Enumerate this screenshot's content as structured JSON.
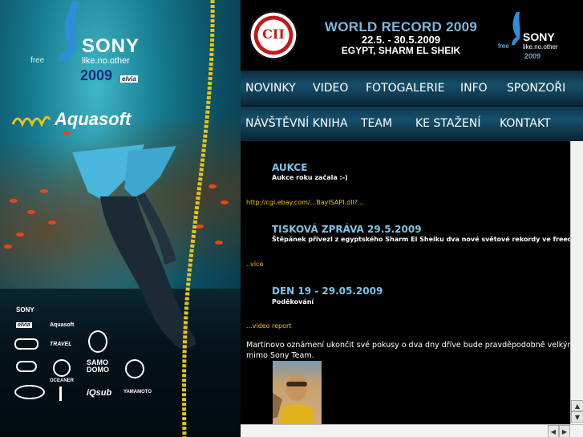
{
  "left_panel": {
    "free_label": "free",
    "sony": "SONY",
    "slogan": "like.no.other",
    "year": "2009",
    "elvia": "elvia",
    "aquasoft": "Aquasoft",
    "sponsors": [
      "SONY",
      "elvia",
      "Aquasoft",
      "TRAVEL",
      "SAMO DOMO",
      "OCEANER",
      "YAMAMOTO",
      "iQsub"
    ]
  },
  "header": {
    "logo_text": "CII",
    "title": "WORLD RECORD 2009",
    "dates": "22.5. - 30.5.2009",
    "place": "EGYPT, SHARM EL SHEIK",
    "sony_free": "free",
    "sony": "SONY",
    "sony_slogan": "like.no.other",
    "sony_year": "2009"
  },
  "nav": {
    "row1": [
      "NOVINKY",
      "VIDEO",
      "FOTOGALERIE",
      "INFO",
      "SPONZOŘI"
    ],
    "row2": [
      "NÁVŠTĚVNÍ KNIHA",
      "TEAM",
      "KE STAŽENÍ",
      "KONTAKT"
    ]
  },
  "posts": [
    {
      "title": "AUKCE",
      "subtitle": "Aukce roku začala :-)",
      "link": "http://cgi.ebay.com/...BayISAPI.dll?..."
    },
    {
      "title": "TISKOVÁ ZPRÁVA 29.5.2009",
      "subtitle": "Štěpánek přivezl z egyptského Sharm El Sheiku dva nové světové rekordy ve freedi",
      "link": "..více"
    },
    {
      "title": "DEN 19 - 29.05.2009",
      "subtitle": "Poděkování",
      "link": "...video report"
    }
  ],
  "body_text": {
    "line1": "Martinovo oznámení ukončit své pokusy o dva dny dříve bude pravděpodobně velkým z",
    "line2": "mimo Sony Team."
  },
  "colors": {
    "post_title": "#7fc3e6",
    "link": "#f2c200",
    "nav_bg": "#164f6b"
  }
}
